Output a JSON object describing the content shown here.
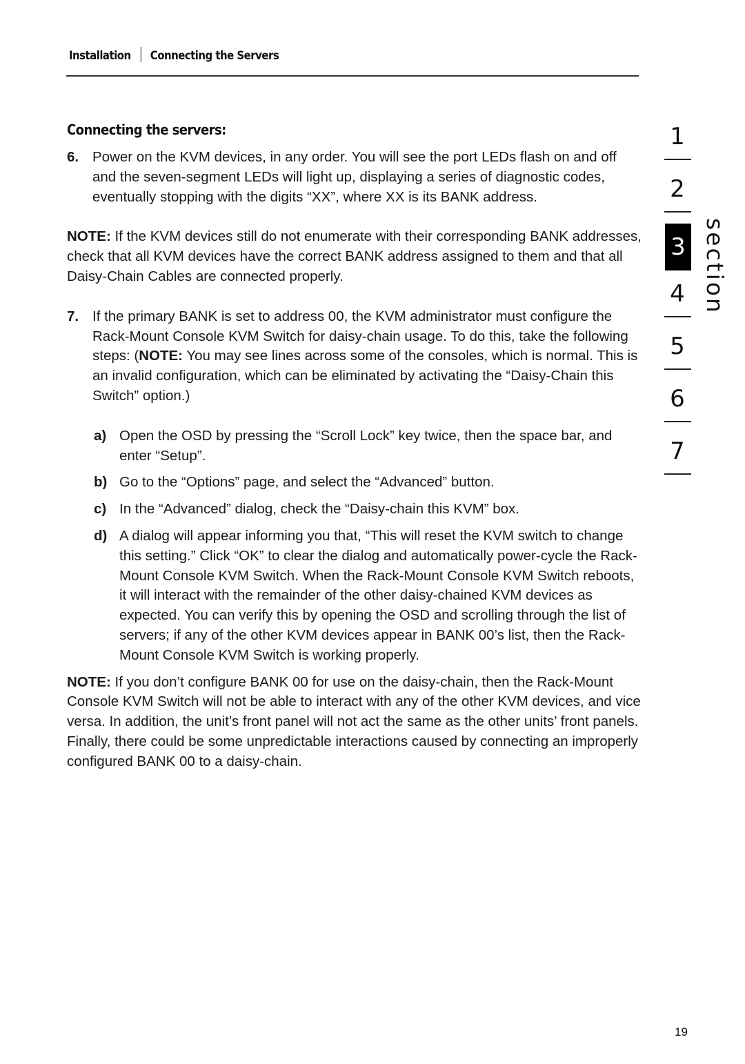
{
  "header": {
    "breadcrumb": [
      "Installation",
      "Connecting the Servers"
    ]
  },
  "section_title": "Connecting the servers:",
  "steps": {
    "step6": {
      "num": "6.",
      "text": "Power on the KVM devices, in any order. You will see the port LEDs flash on and off and the seven-segment LEDs will light up, displaying a series of diagnostic codes, eventually stopping with the digits “XX”, where XX is its BANK address."
    },
    "note1": {
      "label": "NOTE:",
      "text": " If the KVM devices still do not enumerate with their corresponding BANK addresses, check that all KVM devices have the correct BANK address assigned to them and that all Daisy-Chain Cables are connected properly."
    },
    "step7": {
      "num": "7.",
      "text_before": "If the primary BANK is set to address 00, the KVM administrator must configure the Rack-Mount Console KVM Switch for daisy-chain usage. To do this, take the following steps: (",
      "note_label": "NOTE:",
      "text_after": " You may see lines across some of the consoles, which is normal. This is an invalid configuration, which can be eliminated by activating the “Daisy-Chain this Switch” option.)"
    },
    "substeps": [
      {
        "label": "a)",
        "text": "Open the OSD by pressing the “Scroll Lock” key twice, then the space bar, and enter “Setup”."
      },
      {
        "label": "b)",
        "text": "Go to the “Options” page, and select the “Advanced” button."
      },
      {
        "label": "c)",
        "text": "In the “Advanced” dialog, check the “Daisy-chain this KVM” box."
      },
      {
        "label": "d)",
        "text": "A dialog will appear informing you that, “This will reset the KVM switch to change this setting.” Click “OK” to clear the dialog and automatically power-cycle the Rack-Mount Console KVM Switch. When the Rack-Mount Console KVM Switch reboots, it will interact with the remainder of the other daisy-chained KVM devices as expected. You can verify this by opening the OSD and scrolling through the list of servers; if any of the other KVM devices appear in BANK 00’s list, then the Rack-Mount Console KVM Switch is working properly."
      }
    ],
    "note2": {
      "label": "NOTE:",
      "text": " If you don’t configure BANK 00 for use on the daisy-chain, then the Rack-Mount Console KVM Switch will not be able to interact with any of the other KVM devices, and vice versa. In addition, the unit’s front panel will not act the same as the other units’ front panels. Finally, there could be some unpredictable interactions caused by connecting an improperly configured BANK 00 to a daisy-chain."
    }
  },
  "section_nav": {
    "word": "section",
    "items": [
      "1",
      "2",
      "3",
      "4",
      "5",
      "6",
      "7"
    ],
    "active": "3"
  },
  "page_number": "19"
}
